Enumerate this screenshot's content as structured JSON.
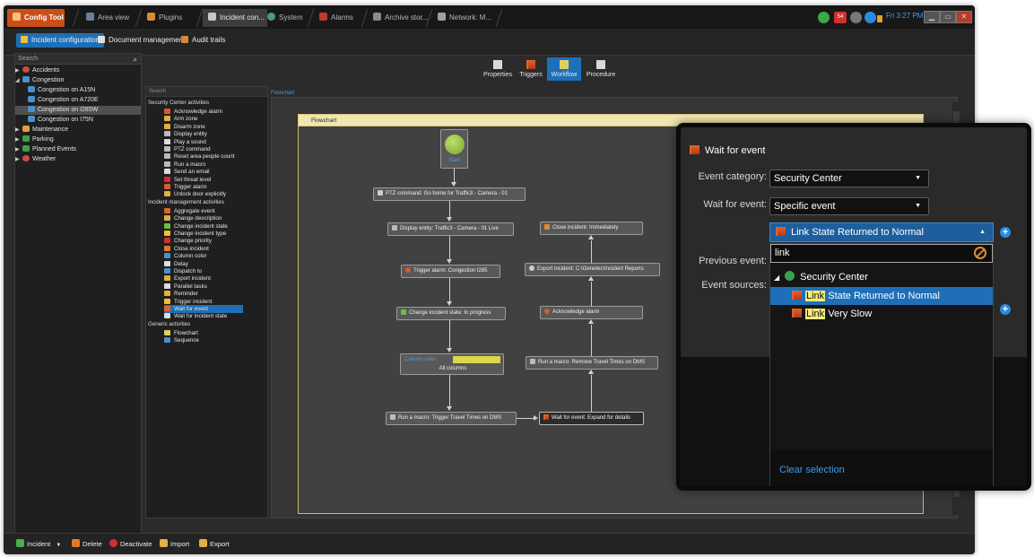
{
  "top_tabs": [
    {
      "label": "Config Tool"
    },
    {
      "label": "Area view"
    },
    {
      "label": "Plugins"
    },
    {
      "label": "Incident con..."
    },
    {
      "label": "System"
    },
    {
      "label": "Alarms"
    },
    {
      "label": "Archive stor..."
    },
    {
      "label": "Network: M..."
    }
  ],
  "tray": {
    "badge": "54",
    "clock": "Fri 3:27 PM"
  },
  "sub_tabs": [
    {
      "label": "Incident configuration"
    },
    {
      "label": "Document management"
    },
    {
      "label": "Audit trails"
    }
  ],
  "tree": {
    "search_placeholder": "Search",
    "items": [
      {
        "label": "Accidents"
      },
      {
        "label": "Congestion"
      },
      {
        "label": "Congestion on A15N"
      },
      {
        "label": "Congestion on A720E"
      },
      {
        "label": "Congestion on I285W"
      },
      {
        "label": "Congestion on I75N"
      },
      {
        "label": "Maintenance"
      },
      {
        "label": "Parking"
      },
      {
        "label": "Planned Events"
      },
      {
        "label": "Weather"
      }
    ]
  },
  "header_buttons": [
    {
      "label": "Properties"
    },
    {
      "label": "Triggers"
    },
    {
      "label": "Workflow"
    },
    {
      "label": "Procedure"
    }
  ],
  "activities": {
    "search_placeholder": "Search",
    "group1_title": "Security Center activities",
    "group1": [
      "Acknowledge alarm",
      "Arm zone",
      "Disarm zone",
      "Display entity",
      "Play a sound",
      "PTZ command",
      "Reset area people count",
      "Run a macro",
      "Send an email",
      "Set threat level",
      "Trigger alarm",
      "Unlock door explicitly"
    ],
    "group2_title": "Incident management activities",
    "group2": [
      "Aggregate event",
      "Change description",
      "Change incident state",
      "Change incident type",
      "Change priority",
      "Close incident",
      "Column color",
      "Delay",
      "Dispatch to",
      "Export incident",
      "Parallel tasks",
      "Reminder",
      "Trigger incident",
      "Wait for event",
      "Wait for incident state"
    ],
    "group3_title": "Generic activities",
    "group3": [
      "Flowchart",
      "Sequence"
    ]
  },
  "flowchart": {
    "breadcrumb": "Flowchart",
    "title": "Flowchart",
    "start_label": "Start",
    "nodes": {
      "ptz": "PTZ command:  Go home for Traffic3 - Camera - 01",
      "display": "Display entity:  Traffic3 - Camera - 01 Live",
      "trigger": "Trigger alarm:  Congestion I285",
      "change_state": "Change incident state:  In progress",
      "column_color_label": "Column color:",
      "column_color_scope": "All columns",
      "run_macro_trigger": "Run a macro:  Trigger Travel Times on DMS",
      "wait_event": "Wait for event:  Expand for details",
      "close": "Close incident:  Immediately",
      "export": "Export incident:  C:\\Genetec\\Incident Reports",
      "ack": "Acknowledge alarm",
      "run_macro_remove": "Run a macro:  Remove Travel Times on DMS"
    },
    "column_color": "#d8d84a"
  },
  "bottom_bar": [
    {
      "label": "Incident"
    },
    {
      "label": "Delete"
    },
    {
      "label": "Deactivate"
    },
    {
      "label": "Import"
    },
    {
      "label": "Export"
    }
  ],
  "popup": {
    "title": "Wait for event",
    "event_category_label": "Event category:",
    "event_category_value": "Security Center",
    "wait_for_label": "Wait for event:",
    "wait_for_value": "Specific event",
    "selected_event": "Link State Returned to Normal",
    "previous_event_label": "Previous event:",
    "event_sources_label": "Event sources:",
    "search_value": "link",
    "tree_root": "Security Center",
    "options": [
      {
        "match": "Link",
        "rest": " State Returned to Normal"
      },
      {
        "match": "Link",
        "rest": " Very Slow"
      }
    ],
    "clear_selection": "Clear selection"
  },
  "colors": {
    "accent": "#1e6fb8",
    "highlight": "#f3ec7a",
    "brand": "#c94f1a"
  }
}
